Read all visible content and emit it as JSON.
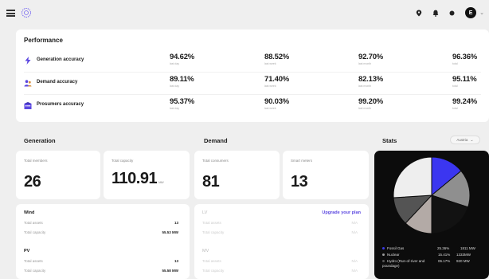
{
  "header": {
    "menu_icon": "menu-icon",
    "logo_icon": "sparkle-logo-icon",
    "icons": [
      "location-pin-icon",
      "bell-icon",
      "dot-icon"
    ],
    "avatar_initial": "E"
  },
  "performance": {
    "title": "Performance",
    "rows": [
      {
        "label": "Generation accuracy",
        "icon": "bolt-icon",
        "metrics": [
          {
            "value": "94.62%",
            "period": "last day"
          },
          {
            "value": "88.52%",
            "period": "last week"
          },
          {
            "value": "92.70%",
            "period": "last month"
          },
          {
            "value": "96.36%",
            "period": "total"
          }
        ]
      },
      {
        "label": "Demand accuracy",
        "icon": "people-icon",
        "metrics": [
          {
            "value": "89.11%",
            "period": "last day"
          },
          {
            "value": "71.40%",
            "period": "last week"
          },
          {
            "value": "82.13%",
            "period": "last month"
          },
          {
            "value": "95.11%",
            "period": "total"
          }
        ]
      },
      {
        "label": "Prosumers accuracy",
        "icon": "building-icon",
        "metrics": [
          {
            "value": "95.37%",
            "period": "last day"
          },
          {
            "value": "90.03%",
            "period": "last week"
          },
          {
            "value": "99.20%",
            "period": "last month"
          },
          {
            "value": "99.24%",
            "period": "total"
          }
        ]
      }
    ]
  },
  "generation": {
    "title": "Generation",
    "total_members_label": "Total members",
    "total_members_value": "26",
    "total_capacity_label": "Total capacity",
    "total_capacity_value": "110.91",
    "total_capacity_unit": "MW",
    "wind": {
      "title": "Wind",
      "assets_label": "Total assets",
      "assets_value": "13",
      "capacity_label": "Total capacity",
      "capacity_value": "55.53 MW"
    },
    "pv": {
      "title": "PV",
      "assets_label": "Total assets",
      "assets_value": "13",
      "capacity_label": "Total capacity",
      "capacity_value": "55.58 MW"
    }
  },
  "demand": {
    "title": "Demand",
    "total_consumers_label": "Total consumers",
    "total_consumers_value": "81",
    "smart_meters_label": "Smart meters",
    "smart_meters_value": "13",
    "lv": {
      "title": "LV",
      "upgrade": "Upgrade your plan",
      "assets_label": "Total assets",
      "assets_value": "N/A",
      "capacity_label": "Total capacity",
      "capacity_value": "N/A"
    },
    "mv": {
      "title": "MV",
      "assets_label": "Total assets",
      "assets_value": "N/A",
      "capacity_label": "Total capacity",
      "capacity_value": "N/A"
    }
  },
  "stats": {
    "title": "Stats",
    "region": "Austria",
    "legend": [
      {
        "name": "Fossil Gas",
        "percent": "25.36%",
        "value": "1811 MW",
        "color": "#3a3ae8"
      },
      {
        "name": "Nuclear",
        "percent": "15.41%",
        "value": "1333MW",
        "color": "#9a9a9a"
      },
      {
        "name": "Hydro (Run-of-river and poundage)",
        "percent": "06.17%",
        "value": "920 MW",
        "color": "#555555"
      }
    ]
  },
  "chart_data": {
    "type": "pie",
    "slices": [
      {
        "color": "#3b36f0",
        "share": 0.14
      },
      {
        "color": "#8f8f8f",
        "share": 0.16
      },
      {
        "color": "#121212",
        "share": 0.2
      },
      {
        "color": "#b3aaa6",
        "share": 0.12
      },
      {
        "color": "#545454",
        "share": 0.12
      },
      {
        "color": "#eeeeee",
        "share": 0.26
      }
    ]
  }
}
